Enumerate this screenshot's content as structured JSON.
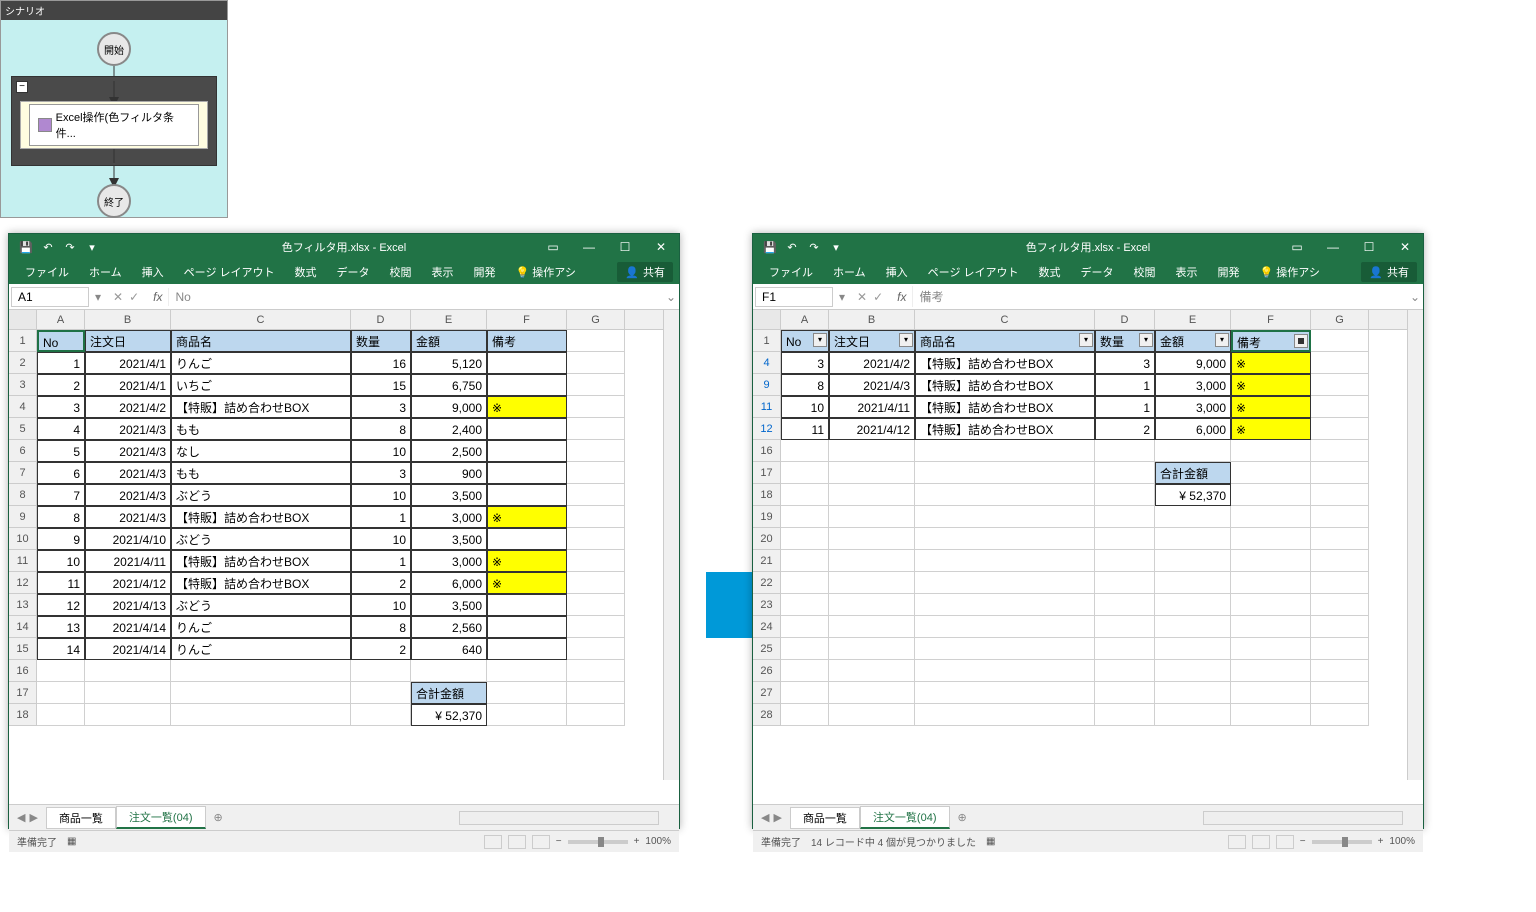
{
  "scenario": {
    "title": "シナリオ",
    "start": "開始",
    "end": "終了",
    "step": "Excel操作(色フィルタ条件..."
  },
  "excel_shared": {
    "title": "色フィルタ用.xlsx - Excel",
    "tabs": {
      "file": "ファイル",
      "home": "ホーム",
      "insert": "挿入",
      "layout": "ページ レイアウト",
      "formulas": "数式",
      "data": "データ",
      "review": "校閲",
      "view": "表示",
      "dev": "開発",
      "tell": "操作アシ"
    },
    "share": "共有",
    "sheets": {
      "s1": "商品一覧",
      "s2": "注文一覧(04)"
    },
    "status_ready": "準備完了",
    "zoom": "100%"
  },
  "left": {
    "cell_ref": "A1",
    "formula_val": "No",
    "cols": {
      "A": 48,
      "B": 86,
      "C": 180,
      "D": 60,
      "E": 76,
      "F": 80,
      "G": 58
    },
    "headers": {
      "no": "No",
      "date": "注文日",
      "name": "商品名",
      "qty": "数量",
      "amt": "金額",
      "note": "備考"
    },
    "rows": [
      {
        "n": "1",
        "no": "1",
        "d": "2021/4/1",
        "nm": "りんご",
        "q": "16",
        "a": "5,120",
        "nt": "",
        "y": false
      },
      {
        "n": "2",
        "no": "2",
        "d": "2021/4/1",
        "nm": "いちご",
        "q": "15",
        "a": "6,750",
        "nt": "",
        "y": false
      },
      {
        "n": "3",
        "no": "3",
        "d": "2021/4/2",
        "nm": "【特販】詰め合わせBOX",
        "q": "3",
        "a": "9,000",
        "nt": "※",
        "y": true
      },
      {
        "n": "4",
        "no": "4",
        "d": "2021/4/3",
        "nm": "もも",
        "q": "8",
        "a": "2,400",
        "nt": "",
        "y": false
      },
      {
        "n": "5",
        "no": "5",
        "d": "2021/4/3",
        "nm": "なし",
        "q": "10",
        "a": "2,500",
        "nt": "",
        "y": false
      },
      {
        "n": "6",
        "no": "6",
        "d": "2021/4/3",
        "nm": "もも",
        "q": "3",
        "a": "900",
        "nt": "",
        "y": false
      },
      {
        "n": "7",
        "no": "7",
        "d": "2021/4/3",
        "nm": "ぶどう",
        "q": "10",
        "a": "3,500",
        "nt": "",
        "y": false
      },
      {
        "n": "8",
        "no": "8",
        "d": "2021/4/3",
        "nm": "【特販】詰め合わせBOX",
        "q": "1",
        "a": "3,000",
        "nt": "※",
        "y": true
      },
      {
        "n": "9",
        "no": "9",
        "d": "2021/4/10",
        "nm": "ぶどう",
        "q": "10",
        "a": "3,500",
        "nt": "",
        "y": false
      },
      {
        "n": "10",
        "no": "10",
        "d": "2021/4/11",
        "nm": "【特販】詰め合わせBOX",
        "q": "1",
        "a": "3,000",
        "nt": "※",
        "y": true
      },
      {
        "n": "11",
        "no": "11",
        "d": "2021/4/12",
        "nm": "【特販】詰め合わせBOX",
        "q": "2",
        "a": "6,000",
        "nt": "※",
        "y": true
      },
      {
        "n": "12",
        "no": "12",
        "d": "2021/4/13",
        "nm": "ぶどう",
        "q": "10",
        "a": "3,500",
        "nt": "",
        "y": false
      },
      {
        "n": "13",
        "no": "13",
        "d": "2021/4/14",
        "nm": "りんご",
        "q": "8",
        "a": "2,560",
        "nt": "",
        "y": false
      },
      {
        "n": "14",
        "no": "14",
        "d": "2021/4/14",
        "nm": "りんご",
        "q": "2",
        "a": "640",
        "nt": "",
        "y": false
      }
    ],
    "total_lbl": "合計金額",
    "total_val": "¥ 52,370",
    "empty_rows": [
      "16",
      "17",
      "18"
    ]
  },
  "right": {
    "cell_ref": "F1",
    "formula_val": "備考",
    "status_extra": "14 レコード中 4 個が見つかりました",
    "cols": {
      "A": 48,
      "B": 86,
      "C": 180,
      "D": 60,
      "E": 76,
      "F": 80,
      "G": 58
    },
    "headers": {
      "no": "No",
      "date": "注文日",
      "name": "商品名",
      "qty": "数量",
      "amt": "金額",
      "note": "備考"
    },
    "rows": [
      {
        "n": "4",
        "no": "3",
        "d": "2021/4/2",
        "nm": "【特販】詰め合わせBOX",
        "q": "3",
        "a": "9,000",
        "nt": "※",
        "y": true
      },
      {
        "n": "9",
        "no": "8",
        "d": "2021/4/3",
        "nm": "【特販】詰め合わせBOX",
        "q": "1",
        "a": "3,000",
        "nt": "※",
        "y": true
      },
      {
        "n": "11",
        "no": "10",
        "d": "2021/4/11",
        "nm": "【特販】詰め合わせBOX",
        "q": "1",
        "a": "3,000",
        "nt": "※",
        "y": true
      },
      {
        "n": "12",
        "no": "11",
        "d": "2021/4/12",
        "nm": "【特販】詰め合わせBOX",
        "q": "2",
        "a": "6,000",
        "nt": "※",
        "y": true
      }
    ],
    "total_lbl": "合計金額",
    "total_val": "¥ 52,370",
    "empty_rows": [
      "16",
      "17",
      "18",
      "19",
      "20",
      "21",
      "22",
      "23",
      "24",
      "25",
      "26",
      "27",
      "28"
    ]
  }
}
